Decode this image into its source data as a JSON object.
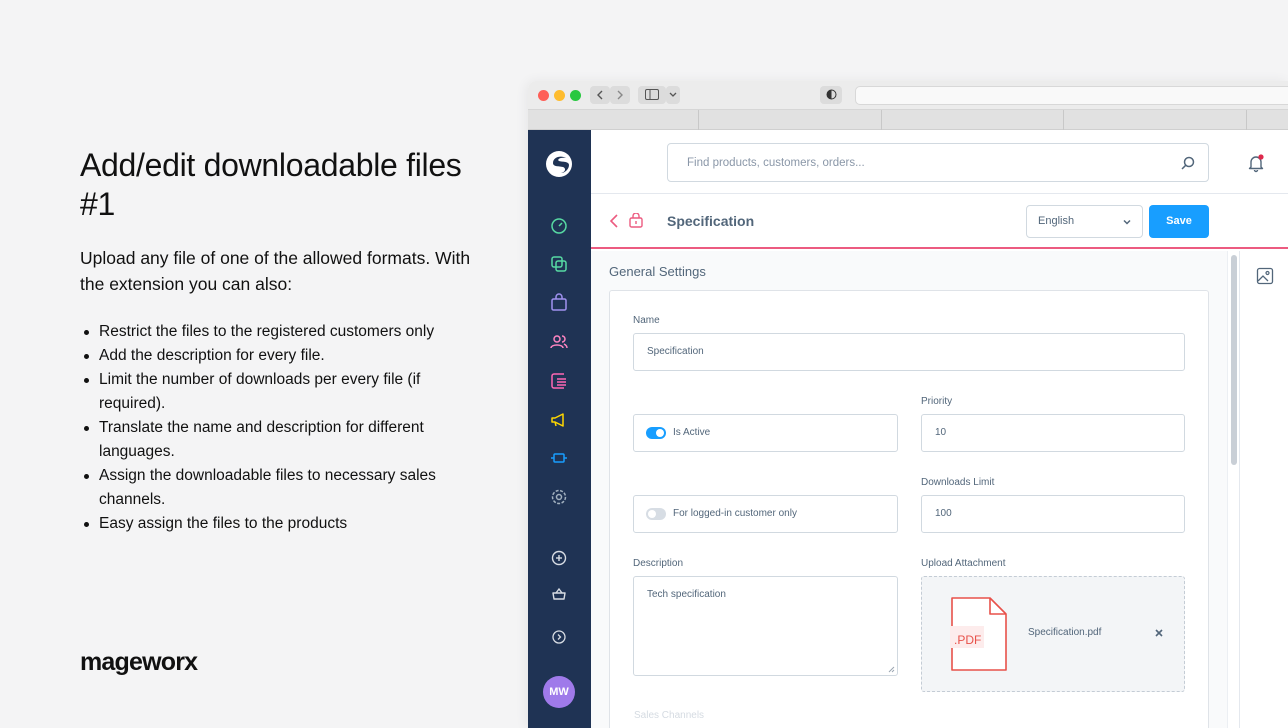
{
  "promo": {
    "title": "Add/edit downloadable files  #1",
    "lead": "Upload any file of one of the allowed formats. With the extension you can also:",
    "bullets": [
      "Restrict the files to the registered customers only",
      "Add the description for every file.",
      "Limit the number of downloads per every file (if required).",
      "Translate the name and description for different languages.",
      "Assign the downloadable files to necessary sales channels.",
      "Easy assign the files to the products"
    ],
    "brand": "mageworx"
  },
  "topbar": {
    "search_placeholder": "Find products, customers, orders..."
  },
  "header": {
    "title": "Specification",
    "language": "English",
    "save_label": "Save"
  },
  "sidebar": {
    "icons": [
      "dashboard-icon",
      "catalogues-icon",
      "orders-icon",
      "customers-icon",
      "content-icon",
      "marketing-icon",
      "extensions-icon",
      "settings-icon",
      "add-icon",
      "shop-icon",
      "collapse-icon"
    ],
    "avatar_initials": "MW"
  },
  "form": {
    "section_title": "General Settings",
    "name_label": "Name",
    "name_value": "Specification",
    "is_active_label": "Is Active",
    "is_active": true,
    "priority_label": "Priority",
    "priority_value": "10",
    "logged_in_label": "For logged-in customer only",
    "logged_in": false,
    "downloads_limit_label": "Downloads Limit",
    "downloads_limit_value": "100",
    "description_label": "Description",
    "description_value": "Tech specification",
    "upload_label": "Upload Attachment",
    "file_badge": ".PDF",
    "file_name": "Specification.pdf",
    "sales_channels_label": "Sales Channels"
  },
  "colors": {
    "nav_bg": "#1f3354",
    "primary": "#189eff",
    "accent_line": "#ec5b80",
    "pdf_red": "#e8514a"
  }
}
